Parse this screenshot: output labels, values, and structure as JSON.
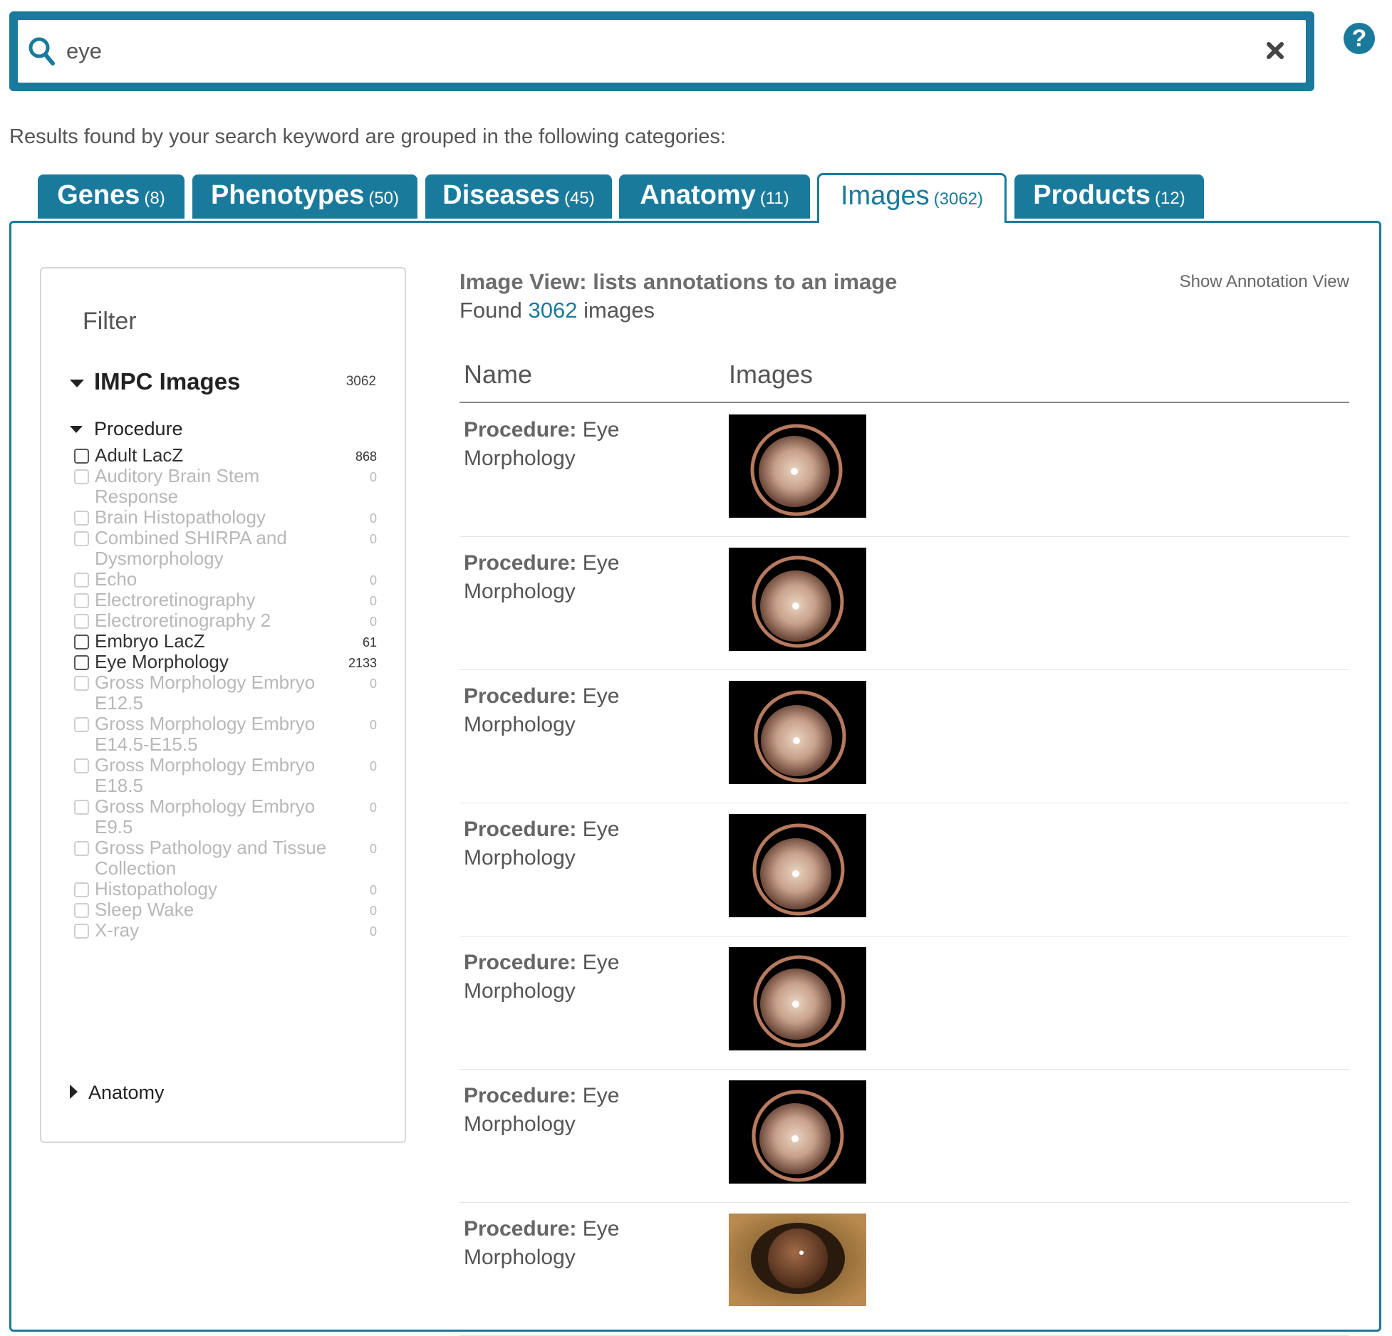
{
  "search": {
    "value": "eye",
    "search_icon": "search-icon",
    "clear_icon": "close-icon"
  },
  "help": {
    "glyph": "?",
    "icon": "question-circle-icon"
  },
  "results_caption": "Results found by your search keyword are grouped in the following categories:",
  "tabs": [
    {
      "label": "Genes",
      "count": "(8)"
    },
    {
      "label": "Phenotypes",
      "count": "(50)"
    },
    {
      "label": "Diseases",
      "count": "(45)"
    },
    {
      "label": "Anatomy",
      "count": "(11)"
    },
    {
      "label": "Images",
      "count": "(3062)",
      "active": true
    },
    {
      "label": "Products",
      "count": "(12)"
    }
  ],
  "filter": {
    "title": "Filter",
    "facet": {
      "label": "IMPC Images",
      "count": "3062"
    },
    "procedure_label": "Procedure",
    "procedures": [
      {
        "label": "Adult LacZ",
        "count": "868",
        "enabled": true
      },
      {
        "label": "Auditory Brain Stem Response",
        "count": "0",
        "enabled": false
      },
      {
        "label": "Brain Histopathology",
        "count": "0",
        "enabled": false
      },
      {
        "label": "Combined SHIRPA and Dysmorphology",
        "count": "0",
        "enabled": false
      },
      {
        "label": "Echo",
        "count": "0",
        "enabled": false
      },
      {
        "label": "Electroretinography",
        "count": "0",
        "enabled": false
      },
      {
        "label": "Electroretinography 2",
        "count": "0",
        "enabled": false
      },
      {
        "label": "Embryo LacZ",
        "count": "61",
        "enabled": true
      },
      {
        "label": "Eye Morphology",
        "count": "2133",
        "enabled": true
      },
      {
        "label": "Gross Morphology Embryo E12.5",
        "count": "0",
        "enabled": false
      },
      {
        "label": "Gross Morphology Embryo E14.5-E15.5",
        "count": "0",
        "enabled": false
      },
      {
        "label": "Gross Morphology Embryo E18.5",
        "count": "0",
        "enabled": false
      },
      {
        "label": "Gross Morphology Embryo E9.5",
        "count": "0",
        "enabled": false
      },
      {
        "label": "Gross Pathology and Tissue Collection",
        "count": "0",
        "enabled": false
      },
      {
        "label": "Histopathology",
        "count": "0",
        "enabled": false
      },
      {
        "label": "Sleep Wake",
        "count": "0",
        "enabled": false
      },
      {
        "label": "X-ray",
        "count": "0",
        "enabled": false
      }
    ],
    "anatomy_label": "Anatomy"
  },
  "results": {
    "view_title": "Image View: lists annotations to an image",
    "found_prefix": "Found",
    "found_count": "3062",
    "found_suffix": "images",
    "annotation_link": "Show Annotation View",
    "columns": {
      "name": "Name",
      "images": "Images"
    },
    "rows": [
      {
        "key": "Procedure",
        "value_line1": "Eye",
        "value_line2": "Morphology",
        "thumb": "eye-fundus-photo"
      },
      {
        "key": "Procedure",
        "value_line1": "Eye",
        "value_line2": "Morphology",
        "thumb": "eye-fundus-photo"
      },
      {
        "key": "Procedure",
        "value_line1": "Eye",
        "value_line2": "Morphology",
        "thumb": "eye-fundus-photo"
      },
      {
        "key": "Procedure",
        "value_line1": "Eye",
        "value_line2": "Morphology",
        "thumb": "eye-fundus-photo"
      },
      {
        "key": "Procedure",
        "value_line1": "Eye",
        "value_line2": "Morphology",
        "thumb": "eye-fundus-photo"
      },
      {
        "key": "Procedure",
        "value_line1": "Eye",
        "value_line2": "Morphology",
        "thumb": "eye-fundus-photo"
      },
      {
        "key": "Procedure",
        "value_line1": "Eye",
        "value_line2": "Morphology",
        "thumb": "eye-closeup-photo"
      }
    ]
  },
  "colors": {
    "brand": "#1a7a9c",
    "text": "#444444",
    "disabled": "#b8b8b8"
  }
}
